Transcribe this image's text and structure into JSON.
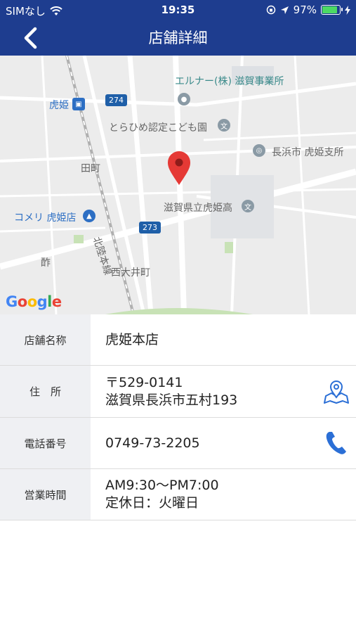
{
  "status_bar": {
    "carrier": "SIMなし",
    "time": "19:35",
    "battery": "97%",
    "battery_level": 0.97
  },
  "nav": {
    "title": "店舗詳細",
    "back_icon": "chevron-left-icon"
  },
  "map": {
    "labels": {
      "company": "エルナー(株) 滋賀事業所",
      "station": "虎姫",
      "nursery": "とらひめ認定こども園",
      "branch": "長浜市 虎姫支所",
      "town1": "田町",
      "school": "滋賀県立虎姫高",
      "store": "コメリ 虎姫店",
      "line": "北陸本線",
      "town2": "酢",
      "town3": "西大井町",
      "route274": "274",
      "route273": "273"
    },
    "logo": "Google",
    "accent_marker": "#e53935"
  },
  "details": [
    {
      "label": "店舗名称",
      "lines": [
        "虎姫本店"
      ],
      "action": null
    },
    {
      "label": "住　所",
      "lines": [
        "〒529-0141",
        "滋賀県長浜市五村193"
      ],
      "action": "map-pin-icon"
    },
    {
      "label": "電話番号",
      "lines": [
        "0749-73-2205"
      ],
      "action": "phone-icon"
    },
    {
      "label": "営業時間",
      "lines": [
        "AM9:30〜PM7:00",
        "定休日：火曜日"
      ],
      "action": null
    }
  ],
  "colors": {
    "header": "#1e3d8f",
    "label_bg": "#eff0f3",
    "action_blue": "#2b6fd6"
  }
}
